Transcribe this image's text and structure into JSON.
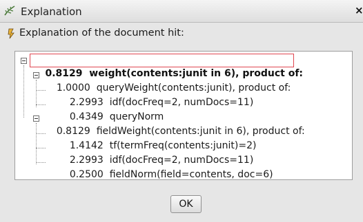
{
  "window": {
    "title": "Explanation",
    "close_glyph": "×",
    "icon": "lucene-feather-icon"
  },
  "header": {
    "icon": "document-hit-icon",
    "text": "Explanation of the document hit:"
  },
  "tree": {
    "nodes": [
      {
        "score": "0.8129",
        "text": "weight(contents:junit in 6), product of:",
        "depth": 0,
        "expanded": true,
        "selected": true
      },
      {
        "score": "1.0000",
        "text": "queryWeight(contents:junit), product of:",
        "depth": 1,
        "expanded": true
      },
      {
        "score": "2.2993",
        "text": "idf(docFreq=2, numDocs=11)",
        "depth": 2
      },
      {
        "score": "0.4349",
        "text": "queryNorm",
        "depth": 2
      },
      {
        "score": "0.8129",
        "text": "fieldWeight(contents:junit in 6), product of:",
        "depth": 1,
        "expanded": true
      },
      {
        "score": "1.4142",
        "text": "tf(termFreq(contents:junit)=2)",
        "depth": 2
      },
      {
        "score": "2.2993",
        "text": "idf(docFreq=2, numDocs=11)",
        "depth": 2
      },
      {
        "score": "0.2500",
        "text": "fieldNorm(field=contents, doc=6)",
        "depth": 2
      }
    ]
  },
  "footer": {
    "ok_label": "OK"
  },
  "colors": {
    "selection_border": "#e0454f",
    "panel_bg": "#ffffff",
    "dialog_bg": "#e6e6e6"
  }
}
